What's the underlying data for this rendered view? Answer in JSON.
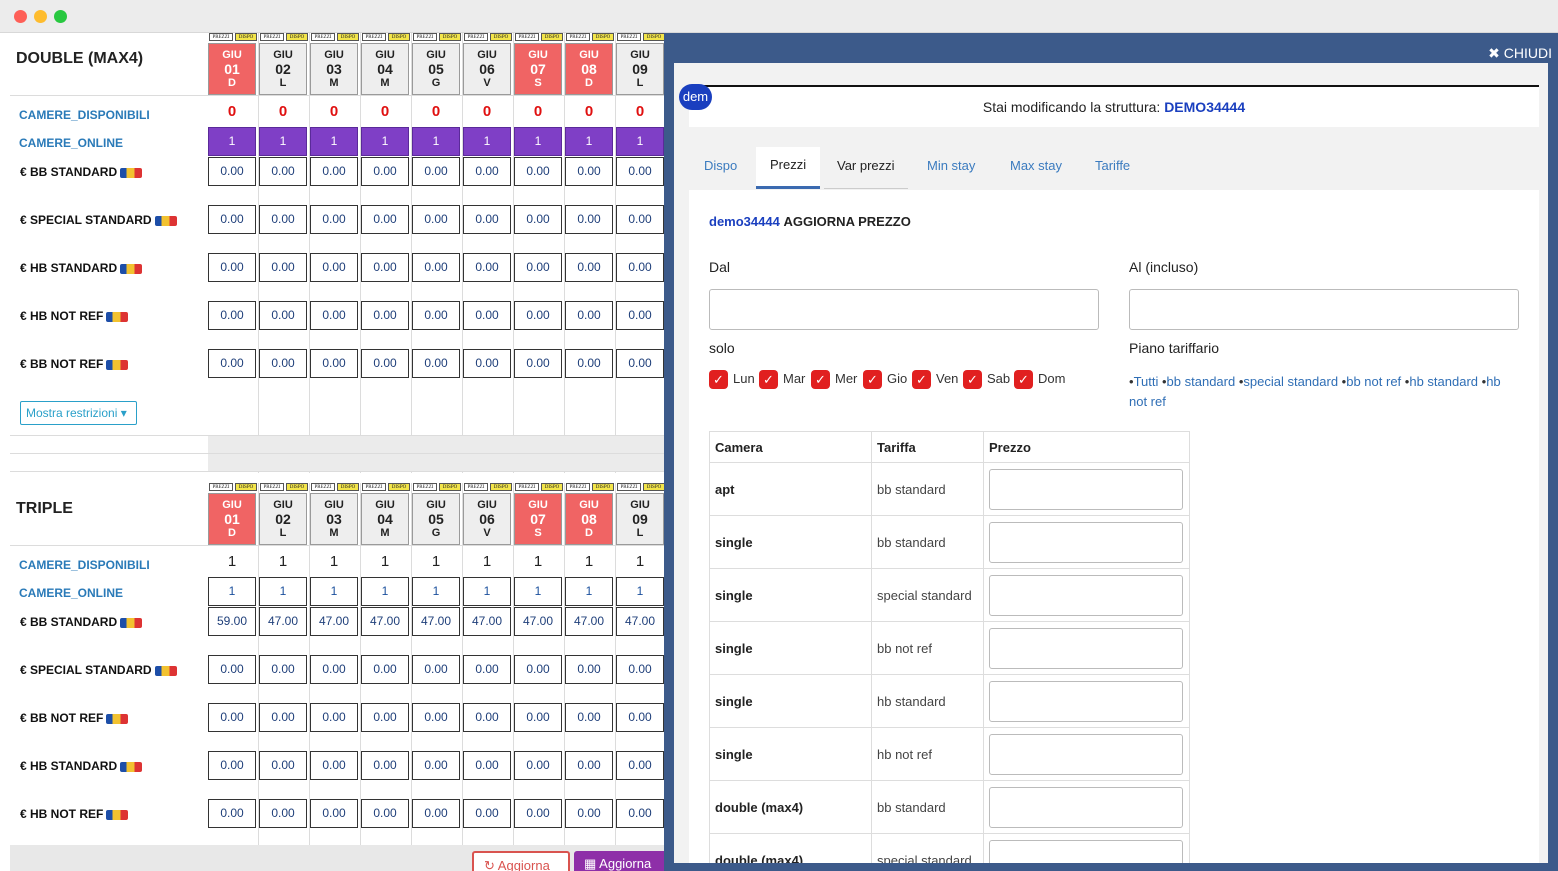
{
  "days": [
    {
      "month": "GIU",
      "num": "01",
      "wd": "D",
      "weekend": true
    },
    {
      "month": "GIU",
      "num": "02",
      "wd": "L",
      "weekend": false
    },
    {
      "month": "GIU",
      "num": "03",
      "wd": "M",
      "weekend": false
    },
    {
      "month": "GIU",
      "num": "04",
      "wd": "M",
      "weekend": false
    },
    {
      "month": "GIU",
      "num": "05",
      "wd": "G",
      "weekend": false
    },
    {
      "month": "GIU",
      "num": "06",
      "wd": "V",
      "weekend": false
    },
    {
      "month": "GIU",
      "num": "07",
      "wd": "S",
      "weekend": true
    },
    {
      "month": "GIU",
      "num": "08",
      "wd": "D",
      "weekend": true
    },
    {
      "month": "GIU",
      "num": "09",
      "wd": "L",
      "weekend": false
    }
  ],
  "tags": {
    "prezzi": "PREZZI",
    "dispo": "DISPO"
  },
  "rooms": [
    {
      "title": "DOUBLE (MAX4)",
      "disponibili_label": "CAMERE_DISPONIBILI",
      "disponibili": [
        "0",
        "0",
        "0",
        "0",
        "0",
        "0",
        "0",
        "0",
        "0"
      ],
      "online_label": "CAMERE_ONLINE",
      "online": [
        "1",
        "1",
        "1",
        "1",
        "1",
        "1",
        "1",
        "1",
        "1"
      ],
      "rates": [
        {
          "label": "€ BB STANDARD",
          "values": [
            "0.00",
            "0.00",
            "0.00",
            "0.00",
            "0.00",
            "0.00",
            "0.00",
            "0.00",
            "0.00"
          ]
        },
        {
          "label": "€ SPECIAL STANDARD",
          "values": [
            "0.00",
            "0.00",
            "0.00",
            "0.00",
            "0.00",
            "0.00",
            "0.00",
            "0.00",
            "0.00"
          ]
        },
        {
          "label": "€ HB STANDARD",
          "values": [
            "0.00",
            "0.00",
            "0.00",
            "0.00",
            "0.00",
            "0.00",
            "0.00",
            "0.00",
            "0.00"
          ]
        },
        {
          "label": "€ HB NOT REF",
          "values": [
            "0.00",
            "0.00",
            "0.00",
            "0.00",
            "0.00",
            "0.00",
            "0.00",
            "0.00",
            "0.00"
          ]
        },
        {
          "label": "€ BB NOT REF",
          "values": [
            "0.00",
            "0.00",
            "0.00",
            "0.00",
            "0.00",
            "0.00",
            "0.00",
            "0.00",
            "0.00"
          ]
        }
      ],
      "restrictions_button": "Mostra restrizioni"
    },
    {
      "title": "TRIPLE",
      "disponibili_label": "CAMERE_DISPONIBILI",
      "disponibili": [
        "1",
        "1",
        "1",
        "1",
        "1",
        "1",
        "1",
        "1",
        "1"
      ],
      "online_label": "CAMERE_ONLINE",
      "online": [
        "1",
        "1",
        "1",
        "1",
        "1",
        "1",
        "1",
        "1",
        "1"
      ],
      "rates": [
        {
          "label": "€ BB STANDARD",
          "values": [
            "59.00",
            "47.00",
            "47.00",
            "47.00",
            "47.00",
            "47.00",
            "47.00",
            "47.00",
            "47.00"
          ]
        },
        {
          "label": "€ SPECIAL STANDARD",
          "values": [
            "0.00",
            "0.00",
            "0.00",
            "0.00",
            "0.00",
            "0.00",
            "0.00",
            "0.00",
            "0.00"
          ]
        },
        {
          "label": "€ BB NOT REF",
          "values": [
            "0.00",
            "0.00",
            "0.00",
            "0.00",
            "0.00",
            "0.00",
            "0.00",
            "0.00",
            "0.00"
          ]
        },
        {
          "label": "€ HB STANDARD",
          "values": [
            "0.00",
            "0.00",
            "0.00",
            "0.00",
            "0.00",
            "0.00",
            "0.00",
            "0.00",
            "0.00"
          ]
        },
        {
          "label": "€ HB NOT REF",
          "values": [
            "0.00",
            "0.00",
            "0.00",
            "0.00",
            "0.00",
            "0.00",
            "0.00",
            "0.00",
            "0.00"
          ]
        }
      ]
    }
  ],
  "footer": {
    "aggiorna": "↻ Aggiorna",
    "aggiorna2": "▦ Aggiorna"
  },
  "panel": {
    "close_label": "✖ CHIUDI",
    "avatar": "dem",
    "struct_prefix": "Stai modificando la struttura:",
    "struct_name": "DEMO34444",
    "tabs": [
      "Dispo",
      "Prezzi",
      "Var prezzi",
      "Min stay",
      "Max stay",
      "Tariffe"
    ],
    "active_tab": "Prezzi",
    "card_title_prefix": "demo34444",
    "card_title": "AGGIORNA PREZZO",
    "dal_label": "Dal",
    "al_label": "Al (incluso)",
    "solo_label": "solo",
    "piano_label": "Piano tariffario",
    "days": [
      "Lun",
      "Mar",
      "Mer",
      "Gio",
      "Ven",
      "Sab",
      "Dom"
    ],
    "plan_links": [
      "Tutti",
      "bb standard",
      "special standard",
      "bb not ref",
      "hb standard",
      "hb not ref"
    ],
    "table_headers": [
      "Camera",
      "Tariffa",
      "Prezzo"
    ],
    "table_rows": [
      {
        "camera": "apt",
        "tariffa": "bb standard"
      },
      {
        "camera": "single",
        "tariffa": "bb standard"
      },
      {
        "camera": "single",
        "tariffa": "special standard"
      },
      {
        "camera": "single",
        "tariffa": "bb not ref"
      },
      {
        "camera": "single",
        "tariffa": "hb standard"
      },
      {
        "camera": "single",
        "tariffa": "hb not ref"
      },
      {
        "camera": "double (max4)",
        "tariffa": "bb standard"
      },
      {
        "camera": "double (max4)",
        "tariffa": "special standard"
      }
    ]
  }
}
